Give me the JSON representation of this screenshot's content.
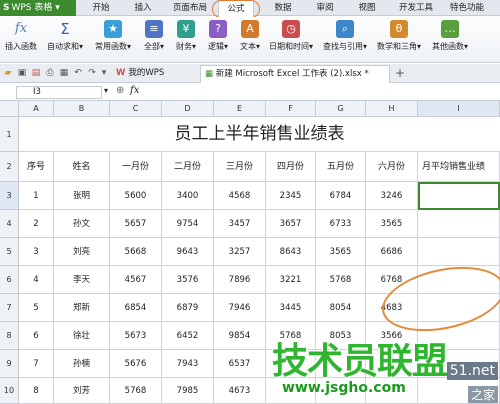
{
  "app": {
    "name": "WPS 表格",
    "logo": "S",
    "accent_color": "#3c8a2e"
  },
  "menu": {
    "tabs": [
      "开始",
      "插入",
      "页面布局",
      "公式",
      "数据",
      "审阅",
      "视图",
      "开发工具",
      "特色功能"
    ],
    "active": "公式"
  },
  "ribbon": {
    "buttons": [
      {
        "label": "插入函数",
        "icon": "fx-icon",
        "glyph": "fx"
      },
      {
        "label": "自动求和▾",
        "icon": "sigma-icon",
        "glyph": "Σ"
      },
      {
        "label": "常用函数▾",
        "icon": "star-icon",
        "glyph": "★"
      },
      {
        "label": "全部▾",
        "icon": "all-functions-icon",
        "glyph": "≡"
      },
      {
        "label": "财务▾",
        "icon": "finance-icon",
        "glyph": "¥"
      },
      {
        "label": "逻辑▾",
        "icon": "logic-icon",
        "glyph": "?"
      },
      {
        "label": "文本▾",
        "icon": "text-icon",
        "glyph": "A"
      },
      {
        "label": "日期和时间▾",
        "icon": "clock-icon",
        "glyph": "◷"
      },
      {
        "label": "查找与引用▾",
        "icon": "lookup-icon",
        "glyph": "⌕"
      },
      {
        "label": "数学和三角▾",
        "icon": "math-icon",
        "glyph": "θ"
      },
      {
        "label": "其他函数▾",
        "icon": "more-functions-icon",
        "glyph": "…"
      }
    ]
  },
  "tabstrip": {
    "tabs": [
      {
        "label": "我的WPS",
        "active": false
      },
      {
        "label": "新建 Microsoft Excel 工作表 (2).xlsx *",
        "active": true
      }
    ],
    "add_glyph": "+"
  },
  "formula_bar": {
    "cell_ref": "I3",
    "fx_label": "fx",
    "value": ""
  },
  "sheet": {
    "columns": [
      "A",
      "B",
      "C",
      "D",
      "E",
      "F",
      "G",
      "H",
      "I"
    ],
    "rows": [
      "1",
      "2",
      "3",
      "4",
      "5",
      "6",
      "7",
      "8",
      "9",
      "10"
    ],
    "title": "员工上半年销售业绩表",
    "headers": [
      "序号",
      "姓名",
      "一月份",
      "二月份",
      "三月份",
      "四月份",
      "五月份",
      "六月份",
      "月平均销售业绩"
    ],
    "data": [
      [
        "1",
        "张明",
        "5600",
        "3400",
        "4568",
        "2345",
        "6784",
        "3246",
        ""
      ],
      [
        "2",
        "孙文",
        "5657",
        "9754",
        "3457",
        "3657",
        "6733",
        "3565",
        ""
      ],
      [
        "3",
        "刘亮",
        "5668",
        "9643",
        "3257",
        "8643",
        "3565",
        "6686",
        ""
      ],
      [
        "4",
        "李天",
        "4567",
        "3576",
        "7896",
        "3221",
        "5768",
        "6768",
        ""
      ],
      [
        "5",
        "郑新",
        "6854",
        "6879",
        "7946",
        "3445",
        "8054",
        "4683",
        ""
      ],
      [
        "6",
        "徐壮",
        "5673",
        "6452",
        "9854",
        "5768",
        "8053",
        "3566",
        ""
      ],
      [
        "7",
        "孙楠",
        "5676",
        "7943",
        "6537",
        "",
        "",
        "",
        ""
      ],
      [
        "8",
        "刘芳",
        "5768",
        "7985",
        "4673",
        "",
        "",
        "",
        ""
      ]
    ],
    "active_cell": "I3"
  },
  "watermark": {
    "main": "技术员联盟",
    "url": "www.jsgho.com",
    "side_top": "51.net",
    "side_bottom": "之家"
  }
}
